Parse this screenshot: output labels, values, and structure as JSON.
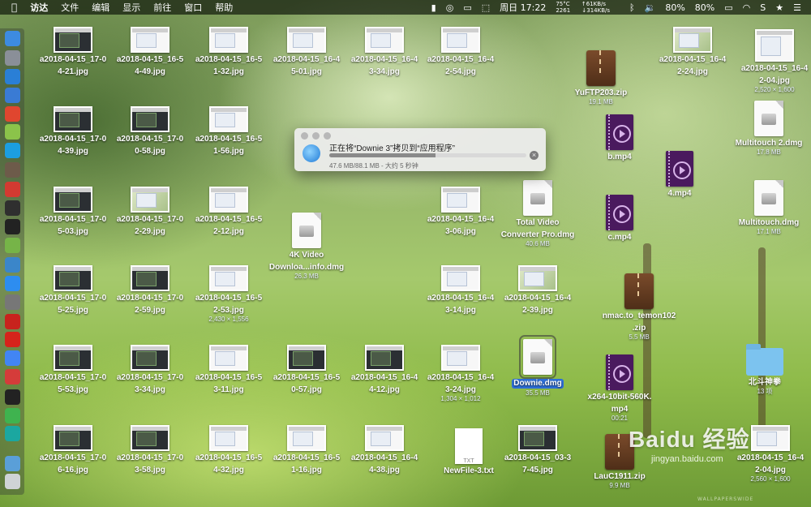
{
  "menubar": {
    "app_name": "访达",
    "menus": [
      "文件",
      "编辑",
      "显示",
      "前往",
      "窗口",
      "帮助"
    ],
    "status": {
      "cpu_temp": "75°C",
      "cpu_rpm": "2261",
      "net_up": "↑61KB/s",
      "net_down": "↓314KB/s",
      "clock": "周日 17:22",
      "volume": "80%",
      "battery": "80%"
    }
  },
  "dock": {
    "apps": [
      {
        "name": "Finder",
        "color": "#3d8be0"
      },
      {
        "name": "Launchpad",
        "color": "#8a8f98"
      },
      {
        "name": "Safari",
        "color": "#2a7fd6"
      },
      {
        "name": "Contacts",
        "color": "#3a7bd4"
      },
      {
        "name": "Baidu",
        "color": "#e0462f"
      },
      {
        "name": "Android",
        "color": "#8bc34a"
      },
      {
        "name": "Migration",
        "color": "#1c9ee0"
      },
      {
        "name": "Disk Utility",
        "color": "#6d5b4a"
      },
      {
        "name": "NetEase Music",
        "color": "#d33a31"
      },
      {
        "name": "Activity",
        "color": "#2f2f2f"
      },
      {
        "name": "Terminal",
        "color": "#222"
      },
      {
        "name": "Maps",
        "color": "#76b448"
      },
      {
        "name": "Mic",
        "color": "#3b86c9"
      },
      {
        "name": "App Store",
        "color": "#2d8df0"
      },
      {
        "name": "System Prefs",
        "color": "#777"
      },
      {
        "name": "Music 163",
        "color": "#c8231d"
      },
      {
        "name": "Yandex",
        "color": "#d5241b"
      },
      {
        "name": "Chrome",
        "color": "#4285f4"
      },
      {
        "name": "Vivaldi",
        "color": "#d53c3a"
      },
      {
        "name": "Console",
        "color": "#222"
      },
      {
        "name": "WeChat",
        "color": "#3fb34f"
      },
      {
        "name": "Browser",
        "color": "#1ba7a0"
      },
      {
        "name": "Downloads",
        "color": "#5a9fd8"
      },
      {
        "name": "Trash",
        "color": "#cfd3d6"
      }
    ]
  },
  "desktop": {
    "images": [
      {
        "label": [
          "a2018-04-15_17-0",
          "4-21.jpg"
        ],
        "style": "dark"
      },
      {
        "label": [
          "a2018-04-15_16-5",
          "4-49.jpg"
        ],
        "style": "light"
      },
      {
        "label": [
          "a2018-04-15_16-5",
          "1-32.jpg"
        ],
        "style": "light"
      },
      {
        "label": [
          "a2018-04-15_16-4",
          "5-01.jpg"
        ],
        "style": "light"
      },
      {
        "label": [
          "a2018-04-15_16-4",
          "3-34.jpg"
        ],
        "style": "light"
      },
      {
        "label": [
          "a2018-04-15_16-4",
          "2-54.jpg"
        ],
        "style": "light"
      },
      {
        "label": [
          "a2018-04-15_17-0",
          "4-39.jpg"
        ],
        "style": "dark"
      },
      {
        "label": [
          "a2018-04-15_17-0",
          "0-58.jpg"
        ],
        "style": "dark"
      },
      {
        "label": [
          "a2018-04-15_16-5",
          "1-56.jpg"
        ],
        "style": "light"
      },
      {
        "label": [
          "a2018-04-15_17-0",
          "5-03.jpg"
        ],
        "style": "dark"
      },
      {
        "label": [
          "a2018-04-15_17-0",
          "2-29.jpg"
        ],
        "style": "photo"
      },
      {
        "label": [
          "a2018-04-15_16-5",
          "2-12.jpg"
        ],
        "style": "light"
      },
      {
        "label": [
          "a2018-04-15_16-4",
          "3-06.jpg"
        ],
        "style": "light"
      },
      {
        "label": [
          "a2018-04-15_17-0",
          "5-25.jpg"
        ],
        "style": "dark"
      },
      {
        "label": [
          "a2018-04-15_17-0",
          "2-59.jpg"
        ],
        "style": "dark"
      },
      {
        "label": [
          "a2018-04-15_16-5",
          "2-53.jpg"
        ],
        "sub": "2,430 × 1,556",
        "style": "light"
      },
      {
        "label": [
          "a2018-04-15_16-4",
          "3-14.jpg"
        ],
        "style": "light"
      },
      {
        "label": [
          "a2018-04-15_16-4",
          "2-39.jpg"
        ],
        "style": "photo"
      },
      {
        "label": [
          "a2018-04-15_17-0",
          "5-53.jpg"
        ],
        "style": "dark"
      },
      {
        "label": [
          "a2018-04-15_17-0",
          "3-34.jpg"
        ],
        "style": "dark"
      },
      {
        "label": [
          "a2018-04-15_16-5",
          "3-11.jpg"
        ],
        "style": "light"
      },
      {
        "label": [
          "a2018-04-15_16-5",
          "0-57.jpg"
        ],
        "style": "dark"
      },
      {
        "label": [
          "a2018-04-15_16-4",
          "4-12.jpg"
        ],
        "style": "dark"
      },
      {
        "label": [
          "a2018-04-15_16-4",
          "3-24.jpg"
        ],
        "sub": "1,304 × 1,012",
        "style": "light"
      },
      {
        "label": [
          "a2018-04-15_17-0",
          "6-16.jpg"
        ],
        "style": "dark"
      },
      {
        "label": [
          "a2018-04-15_17-0",
          "3-58.jpg"
        ],
        "style": "dark"
      },
      {
        "label": [
          "a2018-04-15_16-5",
          "4-32.jpg"
        ],
        "style": "light"
      },
      {
        "label": [
          "a2018-04-15_16-5",
          "1-16.jpg"
        ],
        "style": "light"
      },
      {
        "label": [
          "a2018-04-15_16-4",
          "4-38.jpg"
        ],
        "style": "light"
      },
      {
        "label": [
          "a2018-04-15_03-3",
          "7-45.jpg"
        ],
        "style": "dark"
      },
      {
        "label": [
          "a2018-04-15_16-4",
          "2-24.jpg"
        ],
        "style": "photo"
      },
      {
        "label": [
          "a2018-04-15_16-4",
          "2-04.jpg"
        ],
        "sub": "2,560 × 1,600",
        "style": "light"
      }
    ],
    "files": {
      "dmg_4k": {
        "label": [
          "4K Video",
          "Downloa...info.dmg"
        ],
        "size": "26.3 MB"
      },
      "dmg_tvc": {
        "label": [
          "Total Video",
          "Converter Pro.dmg"
        ],
        "size": "40.6 MB"
      },
      "dmg_downie": {
        "label": "Downie.dmg",
        "size": "35.5 MB"
      },
      "dmg_multitouch2": {
        "label": "Multitouch 2.dmg",
        "size": "17.8 MB"
      },
      "dmg_multitouch": {
        "label": "Multitouch.dmg",
        "size": "17.1 MB"
      },
      "zip_yuftp": {
        "label": "YuFTP203.zip",
        "size": "19.1 MB"
      },
      "zip_nmac": {
        "label": [
          "nmac.to_temon102",
          ".zip"
        ],
        "size": "5.5 MB"
      },
      "zip_lau": {
        "label": "LauC1911.zip",
        "size": "9.9 MB"
      },
      "mp4_b": {
        "label": "b.mp4"
      },
      "mp4_4": {
        "label": "4.mp4"
      },
      "mp4_c": {
        "label": "c.mp4"
      },
      "mp4_x264": {
        "label": [
          "x264-10bit-560K.",
          "mp4"
        ],
        "duration": "00:21"
      },
      "txt_newfile": {
        "label": "NewFile-3.txt",
        "badge": "TXT"
      },
      "folder_beidou": {
        "label": "北斗神拳",
        "count": "13 项"
      },
      "top_right_img": {
        "label": [
          "a2018-04-15_16-4",
          "2-04.jpg"
        ],
        "sub": "2,520 × 1,600"
      }
    }
  },
  "copy_dialog": {
    "title": "正在将“Downie 3”拷贝到“应用程序”",
    "detail": "47.6 MB/88.1 MB - 大约 5 秒钟",
    "progress_fraction": 0.54
  },
  "watermark": {
    "logo": "Baidu 经验",
    "url": "jingyan.baidu.com",
    "credit": "WALLPAPERSWIDE"
  }
}
